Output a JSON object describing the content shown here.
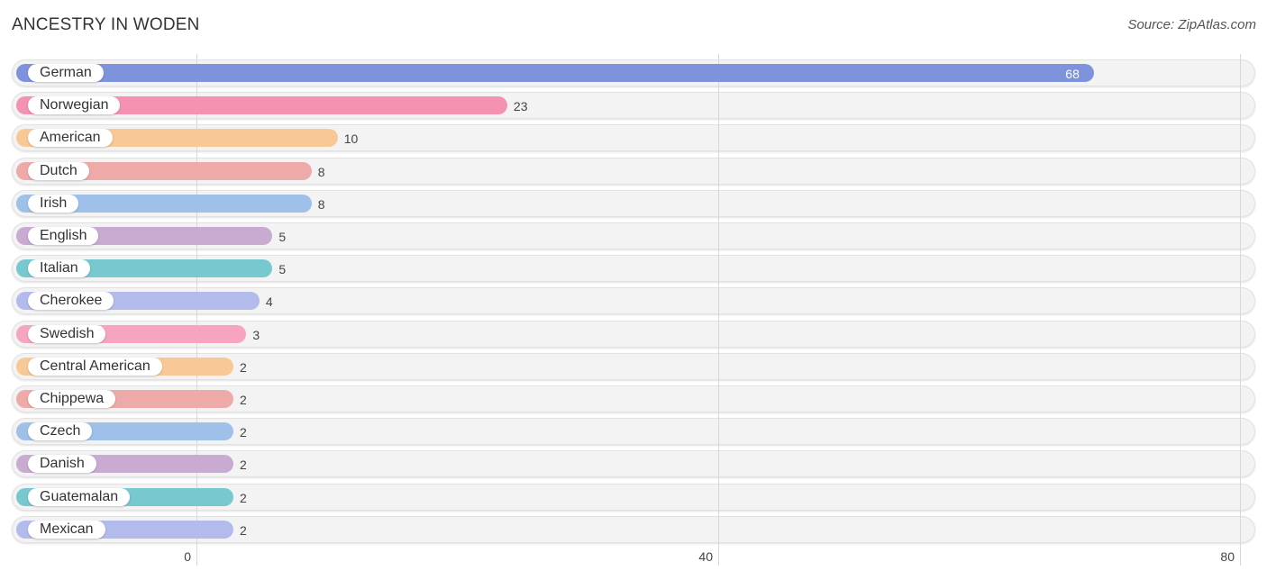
{
  "header": {
    "title": "ANCESTRY IN WODEN",
    "source": "Source: ZipAtlas.com"
  },
  "chart_data": {
    "type": "bar",
    "orientation": "horizontal",
    "title": "ANCESTRY IN WODEN",
    "source": "Source: ZipAtlas.com",
    "xlabel": "",
    "ylabel": "",
    "xlim": [
      0,
      80
    ],
    "xticks": [
      0,
      40,
      80
    ],
    "grid": true,
    "categories": [
      "German",
      "Norwegian",
      "American",
      "Dutch",
      "Irish",
      "English",
      "Italian",
      "Cherokee",
      "Swedish",
      "Central American",
      "Chippewa",
      "Czech",
      "Danish",
      "Guatemalan",
      "Mexican"
    ],
    "values": [
      68,
      23,
      10,
      8,
      8,
      5,
      5,
      4,
      3,
      2,
      2,
      2,
      2,
      2,
      2
    ],
    "colors": [
      "#7f93dd",
      "#f592b2",
      "#f9c897",
      "#eea9a9",
      "#9fc0e8",
      "#c9abd2",
      "#78c8cf",
      "#b3bbec",
      "#f6a4c0",
      "#f9c897",
      "#eea9a9",
      "#9fc0e8",
      "#c9abd2",
      "#78c8cf",
      "#b3bbec"
    ]
  }
}
